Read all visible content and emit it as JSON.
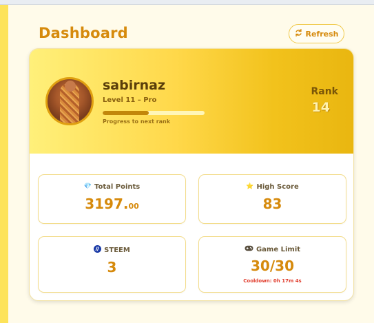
{
  "page": {
    "title": "Dashboard",
    "refresh_label": "Refresh"
  },
  "profile": {
    "username": "sabirnaz",
    "level": "Level 11 – Pro",
    "progress_label": "Progress to next rank",
    "progress_fraction": 0.45,
    "rank_label": "Rank",
    "rank_value": "14"
  },
  "stats": {
    "total_points": {
      "icon": "gem-icon",
      "label": "Total Points",
      "value_main": "3197.",
      "value_decimal": "00"
    },
    "high_score": {
      "icon": "star-icon",
      "label": "High Score",
      "value": "83"
    },
    "steem": {
      "icon": "steem-icon",
      "label": "STEEM",
      "value": "3"
    },
    "game_limit": {
      "icon": "gamepad-icon",
      "label": "Game Limit",
      "value": "30/30",
      "cooldown": "Cooldown: 0h 17m 4s"
    }
  },
  "colors": {
    "accent": "#d68a0c",
    "banner_start": "#fff07a",
    "banner_end": "#e9b610",
    "cooldown": "#e03a2a",
    "left_bar": "#fde35a"
  }
}
